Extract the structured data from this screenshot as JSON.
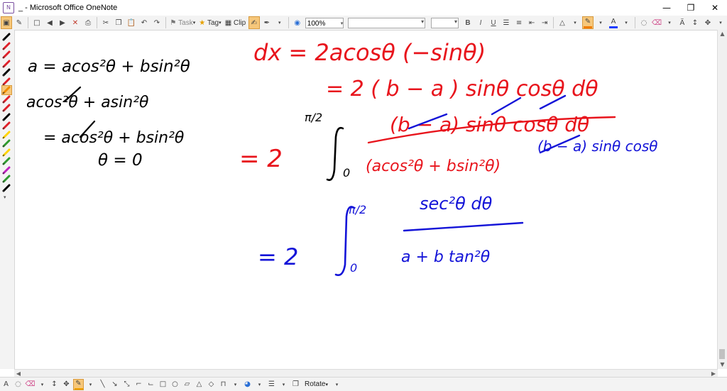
{
  "window": {
    "title": "_ - Microsoft Office OneNote",
    "app_icon": "N",
    "minimize_glyph": "—",
    "restore_glyph": "❐",
    "close_glyph": "✕"
  },
  "toolbar": {
    "task_label": "Task",
    "tag_label": "Tag",
    "clip_label": "Clip",
    "zoom_value": "100%",
    "bold": "B",
    "italic": "I",
    "underline": "U",
    "highlight_color": "#ffd400",
    "font_color": "#1a3cff",
    "pen_color": "#f07c00"
  },
  "bottombar": {
    "rotate_label": "Rotate",
    "active_pen_color": "#f0a000"
  },
  "left_pens": [
    {
      "color": "#000000"
    },
    {
      "color": "#e0202a"
    },
    {
      "color": "#e0202a"
    },
    {
      "color": "#e0202a"
    },
    {
      "color": "#000000"
    },
    {
      "color": "#e0202a"
    },
    {
      "color": "#f08c00"
    },
    {
      "color": "#e0202a"
    },
    {
      "color": "#e0202a"
    },
    {
      "color": "#000000"
    },
    {
      "color": "#e0202a"
    },
    {
      "color": "#ffd400"
    },
    {
      "color": "#2e9a2e"
    },
    {
      "color": "#ffd400"
    },
    {
      "color": "#2e9a2e"
    },
    {
      "color": "#c020c0"
    },
    {
      "color": "#2e9a2e"
    },
    {
      "color": "#000000"
    }
  ],
  "ink": {
    "black_color": "#000000",
    "red_color": "#e8141c",
    "blue_color": "#1414d8",
    "black": {
      "line1": "a = acos²θ + bsin²θ",
      "line2": "acos²θ + asin²θ",
      "line3": "= acos²θ + bsin²θ",
      "line4": "θ = 0"
    },
    "red": {
      "line1": "dx = 2acosθ (−sinθ)",
      "line2": "= 2 ( b − a ) sinθ cosθ dθ",
      "eq": "= 2",
      "upper_limit": "π/2",
      "lower_limit": "0",
      "numerator": "(b − a) sinθ cosθ dθ",
      "denominator": "(acos²θ + bsin²θ)"
    },
    "blue": {
      "cancel_note": "(b − a) sinθ cosθ",
      "eq": "= 2",
      "upper_limit": "π/2",
      "lower_limit": "0",
      "numerator": "sec²θ dθ",
      "denominator": "a + b tan²θ"
    }
  }
}
